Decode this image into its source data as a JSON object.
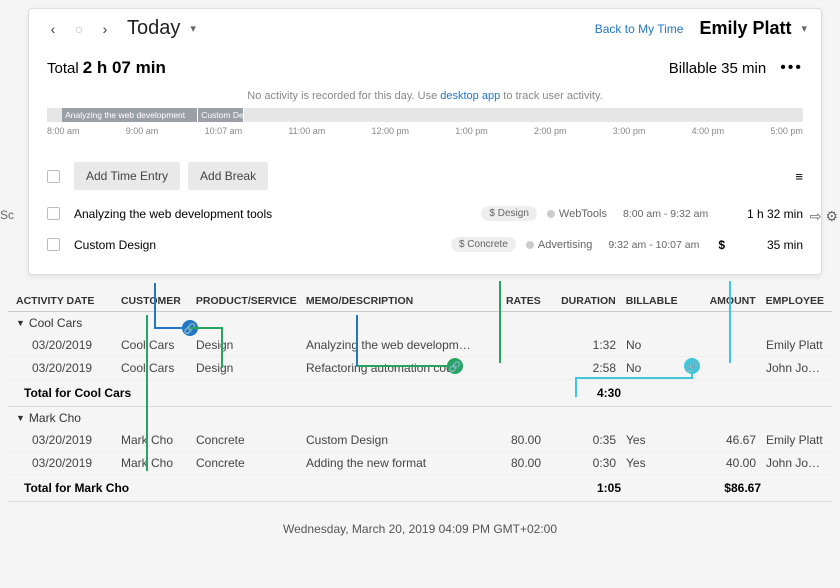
{
  "header": {
    "title": "Today",
    "back": "Back to My Time",
    "user": "Emily Platt"
  },
  "summary": {
    "total_lbl": "Total",
    "total_val": "2 h 07 min",
    "bill_lbl": "Billable",
    "bill_val": "35 min"
  },
  "noact": {
    "a": "No activity is recorded for this day. Use ",
    "link": "desktop app",
    "b": " to track user activity."
  },
  "ticks": [
    "8:00 am",
    "9:00 am",
    "10:07 am",
    "11:00 am",
    "12:00 pm",
    "1:00 pm",
    "2:00 pm",
    "3:00 pm",
    "4:00 pm",
    "5:00 pm"
  ],
  "segs": [
    {
      "t": "Analyzing the web development"
    },
    {
      "t": "Custom De"
    }
  ],
  "buttons": {
    "add_entry": "Add Time Entry",
    "add_break": "Add Break"
  },
  "rows": [
    {
      "desc": "Analyzing the web development tools",
      "tag": "$ Design",
      "proj": "WebTools",
      "range": "8:00 am - 9:32 am",
      "dlr": "",
      "dur": "1 h 32 min"
    },
    {
      "desc": "Custom Design",
      "tag": "$ Concrete",
      "proj": "Advertising",
      "range": "9:32 am - 10:07 am",
      "dlr": "$",
      "dur": "35 min"
    }
  ],
  "cols": {
    "date": "ACTIVITY DATE",
    "cust": "CUSTOMER",
    "prod": "PRODUCT/SERVICE",
    "memo": "MEMO/DESCRIPTION",
    "rate": "RATES",
    "dur": "DURATION",
    "bill": "BILLABLE",
    "amt": "AMOUNT",
    "emp": "EMPLOYEE"
  },
  "g1": {
    "name": "Cool Cars",
    "tot_lbl": "Total for Cool Cars",
    "tot_dur": "4:30",
    "rows": [
      {
        "date": "03/20/2019",
        "cust": "Cool Cars",
        "prod": "Design",
        "memo": "Analyzing the web developm…",
        "rate": "",
        "dur": "1:32",
        "bill": "No",
        "amt": "",
        "emp": "Emily Platt"
      },
      {
        "date": "03/20/2019",
        "cust": "Cool Cars",
        "prod": "Design",
        "memo": "Refactoring automation code",
        "rate": "",
        "dur": "2:58",
        "bill": "No",
        "amt": "",
        "emp": "John Johnson"
      }
    ]
  },
  "g2": {
    "name": "Mark Cho",
    "tot_lbl": "Total for Mark Cho",
    "tot_dur": "1:05",
    "tot_amt": "$86.67",
    "rows": [
      {
        "date": "03/20/2019",
        "cust": "Mark Cho",
        "prod": "Concrete",
        "memo": "Custom Design",
        "rate": "80.00",
        "dur": "0:35",
        "bill": "Yes",
        "amt": "46.67",
        "emp": "Emily Platt"
      },
      {
        "date": "03/20/2019",
        "cust": "Mark Cho",
        "prod": "Concrete",
        "memo": "Adding the new format",
        "rate": "80.00",
        "dur": "0:30",
        "bill": "Yes",
        "amt": "40.00",
        "emp": "John Johnson"
      }
    ]
  },
  "footer": "Wednesday, March 20, 2019   04:09 PM GMT+02:00",
  "side": "Sc"
}
